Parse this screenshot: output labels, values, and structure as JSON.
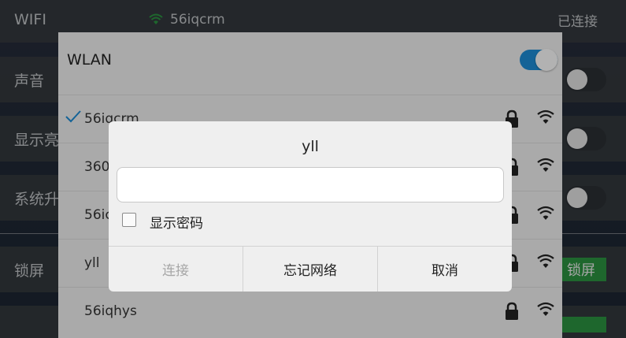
{
  "settings": {
    "wifi_label": "WIFI",
    "wifi_ssid": "56iqcrm",
    "wifi_status": "已连接",
    "sound_label": "声音",
    "brightness_label": "显示亮",
    "upgrade_label": "系统升",
    "lock_label": "锁屏",
    "lock_button": "锁屏"
  },
  "wlan": {
    "title": "WLAN",
    "enabled": true,
    "networks": [
      {
        "ssid": "56iqcrm",
        "connected": true,
        "secured": true
      },
      {
        "ssid": "360",
        "connected": false,
        "secured": true
      },
      {
        "ssid": "56ic",
        "connected": false,
        "secured": true
      },
      {
        "ssid": "yll",
        "connected": false,
        "secured": true
      },
      {
        "ssid": "56iqhys",
        "connected": false,
        "secured": true
      }
    ]
  },
  "dialog": {
    "title": "yll",
    "password_value": "",
    "show_password_label": "显示密码",
    "show_password_checked": false,
    "connect_label": "连接",
    "forget_label": "忘记网络",
    "cancel_label": "取消"
  },
  "colors": {
    "accent": "#1c8ad1",
    "wifi_green": "#2e9e45",
    "lock_button": "#2e9e45"
  }
}
